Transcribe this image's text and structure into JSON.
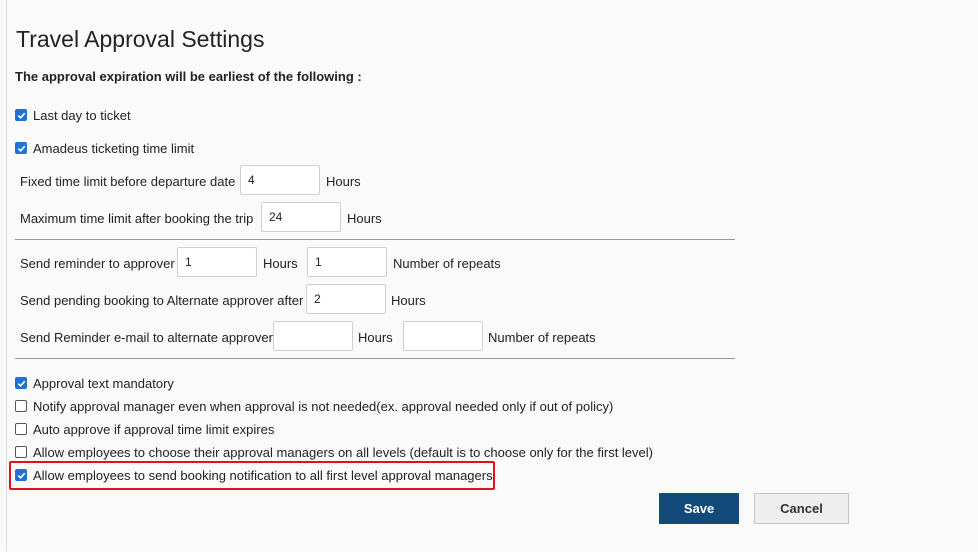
{
  "title": "Travel Approval Settings",
  "subtitle": "The approval expiration will be earliest of the following :",
  "checkboxes_top": [
    {
      "label": "Last day to ticket",
      "checked": true
    },
    {
      "label": "Amadeus ticketing time limit",
      "checked": true
    }
  ],
  "fixed_limit": {
    "label": "Fixed time limit before departure date",
    "value": "4",
    "unit": "Hours"
  },
  "max_limit": {
    "label": "Maximum time limit after booking the trip",
    "value": "24",
    "unit": "Hours"
  },
  "reminder": {
    "label": "Send reminder to approver",
    "value": "1",
    "unit": "Hours",
    "repeats_value": "1",
    "repeats_label": "Number of repeats"
  },
  "alternate": {
    "label": "Send pending booking to Alternate approver after",
    "value": "2",
    "unit": "Hours"
  },
  "alt_reminder": {
    "label": "Send Reminder e-mail to alternate approver",
    "value": "",
    "unit": "Hours",
    "repeats_value": "",
    "repeats_label": "Number of repeats"
  },
  "options": [
    {
      "label": "Approval text mandatory",
      "checked": true
    },
    {
      "label": "Notify approval manager even when approval is not needed(ex. approval needed only if out of policy)",
      "checked": false
    },
    {
      "label": "Auto approve if approval time limit expires",
      "checked": false
    },
    {
      "label": "Allow employees to choose their approval managers on all levels (default is to choose only for the first level)",
      "checked": false
    },
    {
      "label": "Allow employees to send booking notification to all first level approval managers",
      "checked": true
    }
  ],
  "buttons": {
    "save": "Save",
    "cancel": "Cancel"
  },
  "colors": {
    "checkbox": "#1f73d6",
    "save_button": "#124a7a",
    "highlight": "#e0121e"
  }
}
